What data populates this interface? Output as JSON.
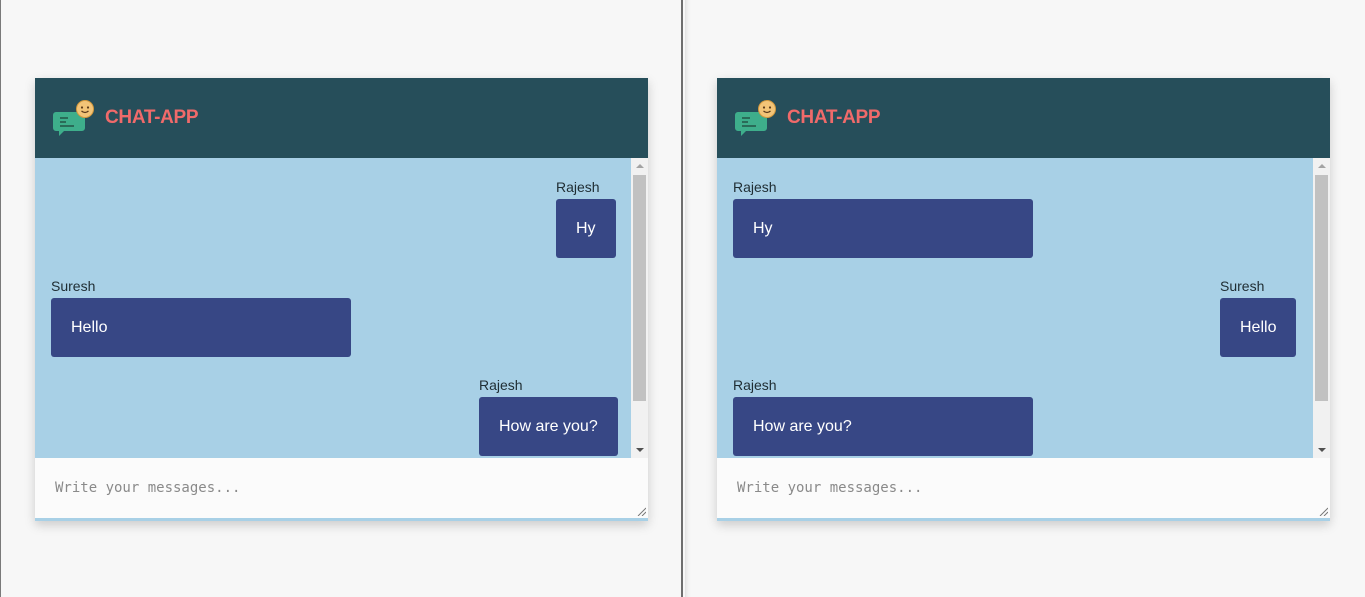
{
  "app": {
    "title": "CHAT-APP",
    "colors": {
      "header_bg": "#264e5a",
      "title": "#f06a6a",
      "messages_bg": "#a8d0e6",
      "bubble_bg": "#374785",
      "bubble_text": "#ffffff"
    }
  },
  "composer": {
    "placeholder": "Write your messages..."
  },
  "left_window": {
    "viewer": "Rajesh",
    "messages": [
      {
        "sender": "Rajesh",
        "text": "Hy",
        "own": true
      },
      {
        "sender": "Suresh",
        "text": "Hello",
        "own": false
      },
      {
        "sender": "Rajesh",
        "text": "How are you?",
        "own": true
      }
    ]
  },
  "right_window": {
    "viewer": "Suresh",
    "messages": [
      {
        "sender": "Rajesh",
        "text": "Hy",
        "own": false
      },
      {
        "sender": "Suresh",
        "text": "Hello",
        "own": true
      },
      {
        "sender": "Rajesh",
        "text": "How are you?",
        "own": false
      }
    ]
  },
  "icons": {
    "logo": "chat-bubble-smiley-icon",
    "resize": "resize-grip-icon"
  }
}
